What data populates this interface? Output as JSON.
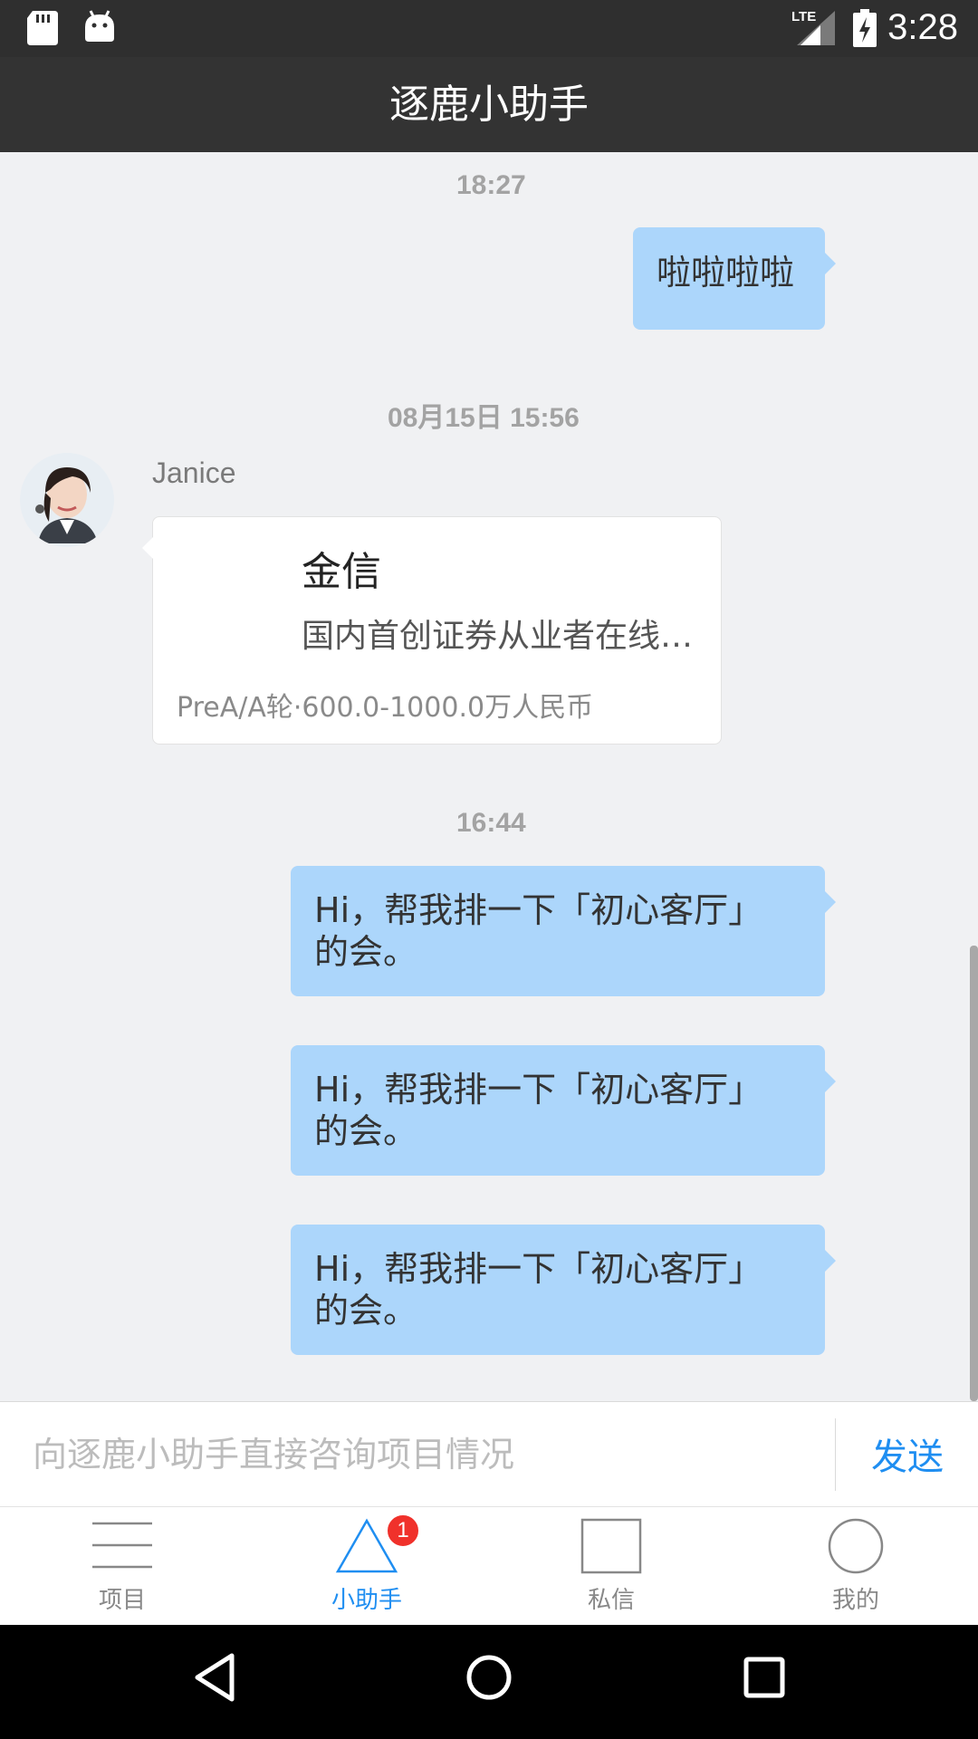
{
  "status_bar": {
    "time": "3:28",
    "network": "LTE",
    "icons": [
      "sd-card-icon",
      "android-icon",
      "lte-signal-icon",
      "battery-charging-icon"
    ]
  },
  "header": {
    "title": "逐鹿小助手"
  },
  "chat": {
    "messages": [
      {
        "type": "time",
        "text": "18:27"
      },
      {
        "type": "outgoing",
        "text": "啦啦啦啦"
      },
      {
        "type": "time",
        "text": "08月15日 15:56"
      },
      {
        "type": "incoming-card",
        "sender": "Janice",
        "card": {
          "title": "金信",
          "description": "国内首创证券从业者在线…",
          "meta": "PreA/A轮·600.0-1000.0万人民币"
        }
      },
      {
        "type": "time",
        "text": "16:44"
      },
      {
        "type": "outgoing",
        "line1": "Hi，帮我排一下「初心客厅」",
        "line2": "的会。"
      },
      {
        "type": "outgoing",
        "line1": "Hi，帮我排一下「初心客厅」",
        "line2": "的会。"
      },
      {
        "type": "outgoing",
        "line1": "Hi，帮我排一下「初心客厅」",
        "line2": "的会。"
      }
    ]
  },
  "input": {
    "placeholder": "向逐鹿小助手直接咨询项目情况",
    "value": "",
    "send_label": "发送"
  },
  "tabs": [
    {
      "label": "项目",
      "icon": "menu-lines-icon",
      "active": false
    },
    {
      "label": "小助手",
      "icon": "triangle-icon",
      "active": true,
      "badge": "1"
    },
    {
      "label": "私信",
      "icon": "square-icon",
      "active": false
    },
    {
      "label": "我的",
      "icon": "circle-icon",
      "active": false
    }
  ],
  "nav_bar": {
    "icons": [
      "back-icon",
      "home-icon",
      "recents-icon"
    ]
  },
  "colors": {
    "status_bar": "#2f2f2f",
    "title_bar": "#333333",
    "chat_bg": "#f0f1f3",
    "outgoing_bubble": "#acd6fb",
    "accent": "#1f8ef1",
    "badge": "#f0312b"
  }
}
